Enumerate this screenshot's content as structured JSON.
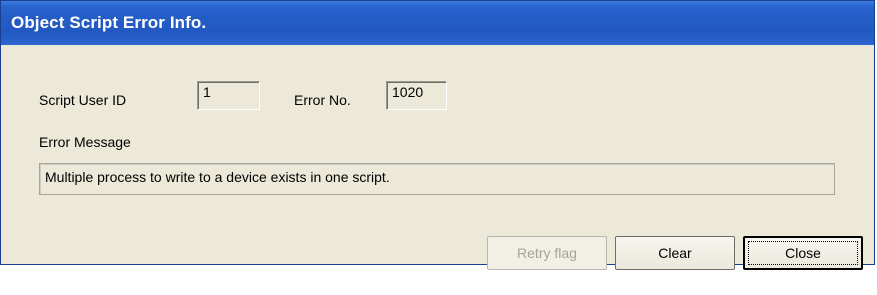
{
  "window": {
    "title": "Object Script Error Info."
  },
  "fields": {
    "script_user_id_label": "Script User ID",
    "script_user_id_value": "1",
    "error_no_label": "Error No.",
    "error_no_value": "1020",
    "error_message_label": "Error Message",
    "error_message_value": "Multiple process to write to a device exists in one script."
  },
  "buttons": {
    "retry_label": "Retry flag",
    "retry_enabled": false,
    "clear_label": "Clear",
    "close_label": "Close"
  }
}
